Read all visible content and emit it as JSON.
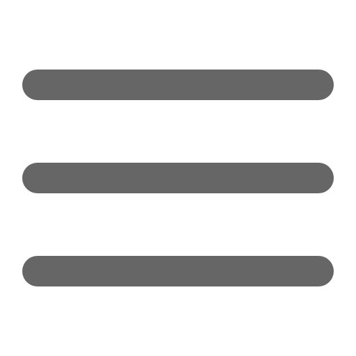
{
  "icon": {
    "name": "hamburger-menu-icon",
    "bar_count": 3,
    "color": "#666666",
    "background": "#ffffff"
  }
}
